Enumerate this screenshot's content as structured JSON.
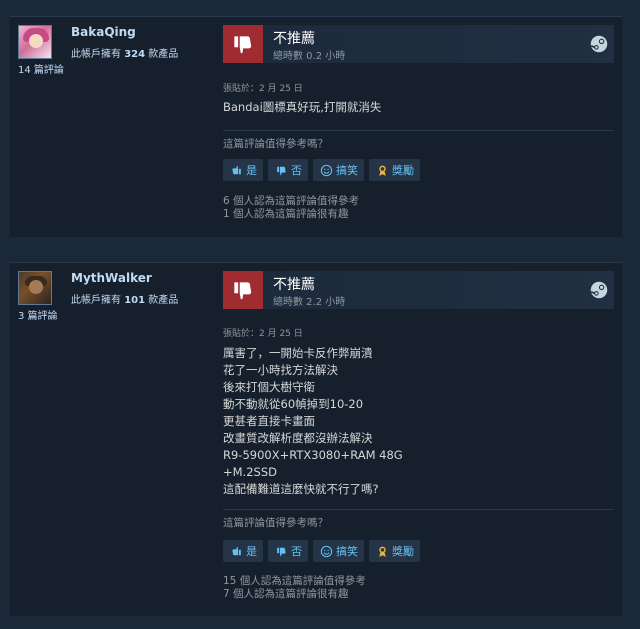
{
  "reviews": [
    {
      "username": "BakaQing",
      "owned_prefix": "此帳戶擁有",
      "owned_count": "324",
      "owned_suffix": "款產品",
      "review_count": "14 篇評論",
      "verdict": "不推薦",
      "hours": "總時數 0.2 小時",
      "posted": "張貼於：2 月 25 日",
      "content": "Bandai圖標真好玩,打開就消失",
      "helpful_question": "這篇評論值得參考嗎？",
      "buttons": {
        "yes": "是",
        "no": "否",
        "funny": "搞笑",
        "award": "獎勵"
      },
      "helpful_count": "6 個人認為這篇評論值得參考",
      "funny_count": "1 個人認為這篇評論很有趣"
    },
    {
      "username": "MythWalker",
      "owned_prefix": "此帳戶擁有",
      "owned_count": "101",
      "owned_suffix": "款產品",
      "review_count": "3 篇評論",
      "verdict": "不推薦",
      "hours": "總時數 2.2 小時",
      "posted": "張貼於：2 月 25 日",
      "content": "厲害了，一開始卡反作弊崩潰\n花了一小時找方法解決\n後來打個大樹守衛\n動不動就從60幀掉到10-20\n更甚者直接卡畫面\n改畫質改解析度都沒辦法解決\nR9-5900X+RTX3080+RAM 48G\n+M.2SSD\n這配備難道這麼快就不行了嗎?",
      "helpful_question": "這篇評論值得參考嗎？",
      "buttons": {
        "yes": "是",
        "no": "否",
        "funny": "搞笑",
        "award": "獎勵"
      },
      "helpful_count": "15 個人認為這篇評論值得參考",
      "funny_count": "7 個人認為這篇評論很有趣"
    }
  ],
  "colors": {
    "background": "#1b2838",
    "card": "#16202d",
    "thumb_down": "#a02c32",
    "button_text": "#66c0f4",
    "username": "#c1dbf4"
  },
  "icons": [
    "thumbs-down-icon",
    "steam-icon",
    "thumbs-up-icon",
    "smiley-icon",
    "award-icon"
  ]
}
